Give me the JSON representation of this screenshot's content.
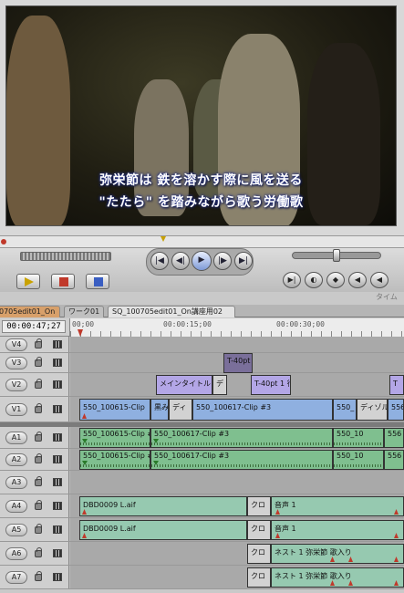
{
  "viewer": {
    "subtitle_line1": "弥栄節は 鉄を溶かす際に風を送る",
    "subtitle_line2": "\"たたら\" を踏みながら歌う労働歌"
  },
  "transport": {
    "rewind": "|◀",
    "step_back": "◀|",
    "play": "▶",
    "step_fwd": "|▶",
    "fwd": "▶|",
    "right_btns": [
      "▶|",
      "◐",
      "◆",
      "◀",
      "◀"
    ],
    "clip_label": "タイム"
  },
  "tabs": [
    "0705edit01_On",
    "ワーク01",
    "SQ_100705edit01_On講座用02"
  ],
  "timeline": {
    "timecode": "00:00:47;27",
    "ruler": [
      "00;00",
      "00:00:15;00",
      "00:00:30;00"
    ]
  },
  "tracks": {
    "v4": "V4",
    "v3": "V3",
    "v2": "V2",
    "v1": "V1",
    "a1": "A1",
    "a2": "A2",
    "a3": "A3",
    "a4": "A4",
    "a5": "A5",
    "a6": "A6",
    "a7": "A7"
  },
  "clips": {
    "v3_title": "T-40pt",
    "v2_main": "メインタイトル",
    "v2_de": "デ",
    "v2_t40": "T-40pt 1 行",
    "v2_t": "T",
    "v1_a": "550_100615-Clip",
    "v1_b": "黒み",
    "v1_c": "ディ",
    "v1_d": "550_100617-Clip #3",
    "v1_e": "550_",
    "v1_f": "ディゾル",
    "v1_g": "556",
    "a1_a": "550_100615-Clip #",
    "a1_b": "550_100617-Clip #3",
    "a1_c": "550_10",
    "a1_d": "556",
    "a2_a": "550_100615-Clip #",
    "a2_b": "550_100617-Clip #3",
    "a2_c": "550_10",
    "a2_d": "556",
    "a4_a": "DBD0009 L.aif",
    "a4_x": "クロ",
    "a4_b": "音声 1",
    "a5_a": "DBD0009 L.aif",
    "a5_x": "クロ",
    "a5_b": "音声 1",
    "a6_x": "クロ",
    "a6_b": "ネスト 1 弥栄節 歌入り",
    "a7_x": "クロ",
    "a7_b": "ネスト 1 弥栄節 歌入り"
  }
}
